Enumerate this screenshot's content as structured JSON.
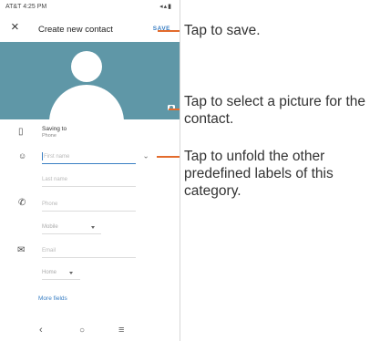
{
  "status": {
    "carrier_time": "AT&T 4:25 PM",
    "icons": "◂▴▮"
  },
  "appbar": {
    "title": "Create new contact",
    "save": "SAVE"
  },
  "saving": {
    "label": "Saving to",
    "value": "Phone"
  },
  "fields": {
    "first_name": "First name",
    "last_name": "Last name",
    "phone": "Phone",
    "phone_label": "Mobile",
    "email": "Email",
    "email_label": "Home"
  },
  "more_fields": "More fields",
  "callouts": {
    "save": "Tap to save.",
    "picture": "Tap to select a picture for the contact.",
    "labels": "Tap to unfold the other predefined labels of this category."
  },
  "colors": {
    "accent": "#3a7fc4",
    "photo_bg": "#5f97a7",
    "callout_line": "#e36b2c"
  }
}
